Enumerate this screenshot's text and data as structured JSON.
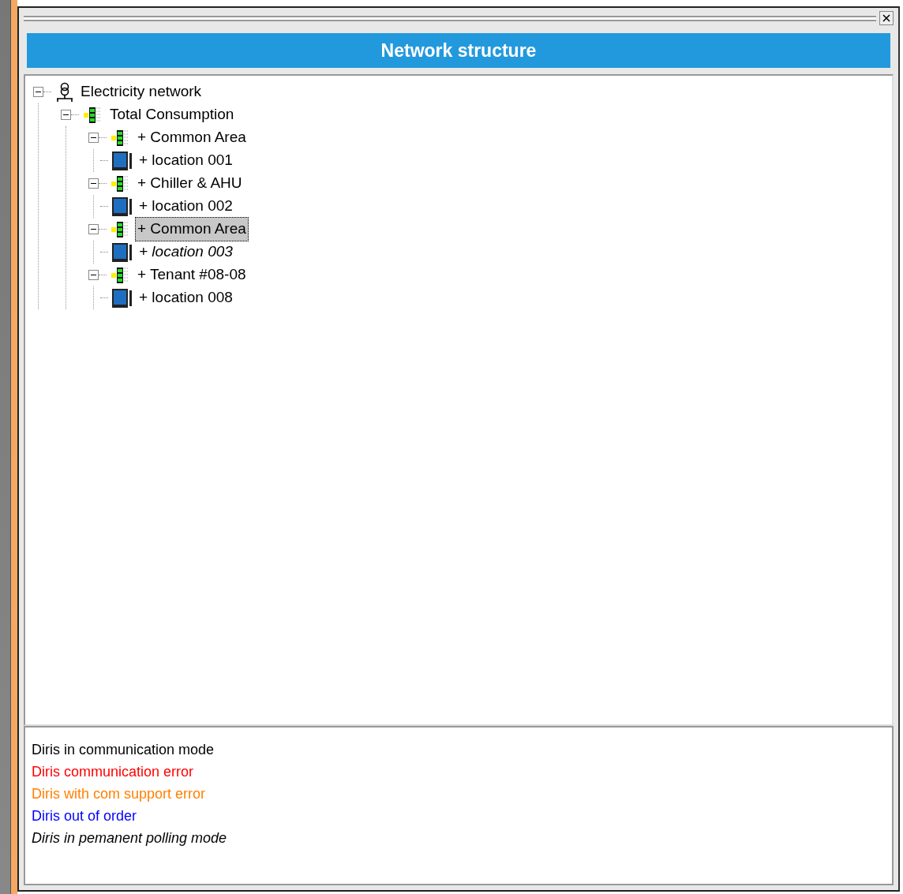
{
  "window": {
    "title": "Network structure"
  },
  "tree": [
    {
      "label": "Electricity network",
      "kind": "network",
      "expanded": true,
      "selected": false,
      "italic": false,
      "children": [
        {
          "label": "Total Consumption",
          "kind": "group",
          "expanded": true,
          "selected": false,
          "italic": false,
          "children": [
            {
              "label": "+ Common Area",
              "kind": "group",
              "expanded": true,
              "selected": false,
              "italic": false,
              "children": [
                {
                  "label": "+ location 001",
                  "kind": "device",
                  "selected": false,
                  "italic": false
                }
              ]
            },
            {
              "label": "+ Chiller & AHU",
              "kind": "group",
              "expanded": true,
              "selected": false,
              "italic": false,
              "children": [
                {
                  "label": "+ location 002",
                  "kind": "device",
                  "selected": false,
                  "italic": false
                }
              ]
            },
            {
              "label": "+ Common Area",
              "kind": "group",
              "expanded": true,
              "selected": true,
              "italic": false,
              "children": [
                {
                  "label": "+ location 003",
                  "kind": "device",
                  "selected": false,
                  "italic": true
                }
              ]
            },
            {
              "label": "+ Tenant #08-08",
              "kind": "group",
              "expanded": true,
              "selected": false,
              "italic": false,
              "children": [
                {
                  "label": "+ location 008",
                  "kind": "device",
                  "selected": false,
                  "italic": false
                }
              ]
            }
          ]
        }
      ]
    }
  ],
  "legend": [
    {
      "text": "Diris in communication mode",
      "color": "#000000",
      "italic": false
    },
    {
      "text": "Diris communication error",
      "color": "#ff0000",
      "italic": false
    },
    {
      "text": "Diris with com support error",
      "color": "#ff8000",
      "italic": false
    },
    {
      "text": "Diris out of order",
      "color": "#0000ff",
      "italic": false
    },
    {
      "text": "Diris in pemanent polling mode",
      "color": "#000000",
      "italic": true
    }
  ]
}
